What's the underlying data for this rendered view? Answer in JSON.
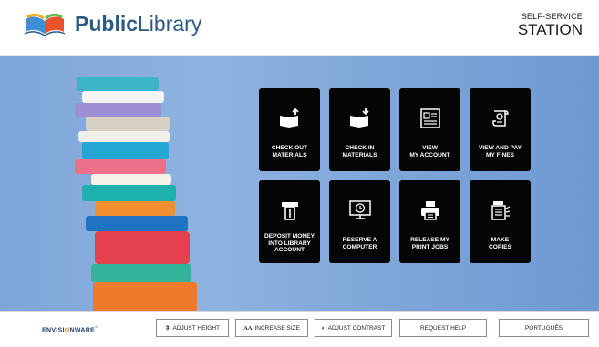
{
  "header": {
    "brand_bold": "Public",
    "brand_light": "Library",
    "station_small": "SELF-SERVICE",
    "station_big": "STATION"
  },
  "tiles": [
    {
      "label": "CHECK OUT\nMATERIALS",
      "icon": "check-out-icon"
    },
    {
      "label": "CHECK IN\nMATERIALS",
      "icon": "check-in-icon"
    },
    {
      "label": "VIEW\nMY ACCOUNT",
      "icon": "account-icon"
    },
    {
      "label": "VIEW AND PAY\nMY FINES",
      "icon": "fines-receipt-icon"
    },
    {
      "label": "DEPOSIT MONEY\nINTO LIBRARY\nACCOUNT",
      "icon": "deposit-icon"
    },
    {
      "label": "RESERVE A\nCOMPUTER",
      "icon": "computer-clock-icon"
    },
    {
      "label": "RELEASE MY\nPRINT JOBS",
      "icon": "printer-icon"
    },
    {
      "label": "MAKE\nCOPIES",
      "icon": "copier-icon"
    }
  ],
  "footer": {
    "vendor_pre": "ENVISI",
    "vendor_o": "O",
    "vendor_post": "NWARE",
    "vendor_mark": "™",
    "adjust_height_glyph": "⇳",
    "adjust_height": "ADJUST HEIGHT",
    "increase_size_glyph": "AA",
    "increase_size": "INCREASE SIZE",
    "adjust_contrast_glyph": "◐",
    "adjust_contrast": "ADJUST CONTRAST",
    "request_help": "REQUEST HELP",
    "portugues": "PORTUGUÊS"
  },
  "colors": {
    "brand": "#2d5a85",
    "hero_bg": "#7ea6d9",
    "tile_bg": "#050505",
    "vendor_blue": "#1e3f73",
    "vendor_orange": "#e58b1f"
  }
}
